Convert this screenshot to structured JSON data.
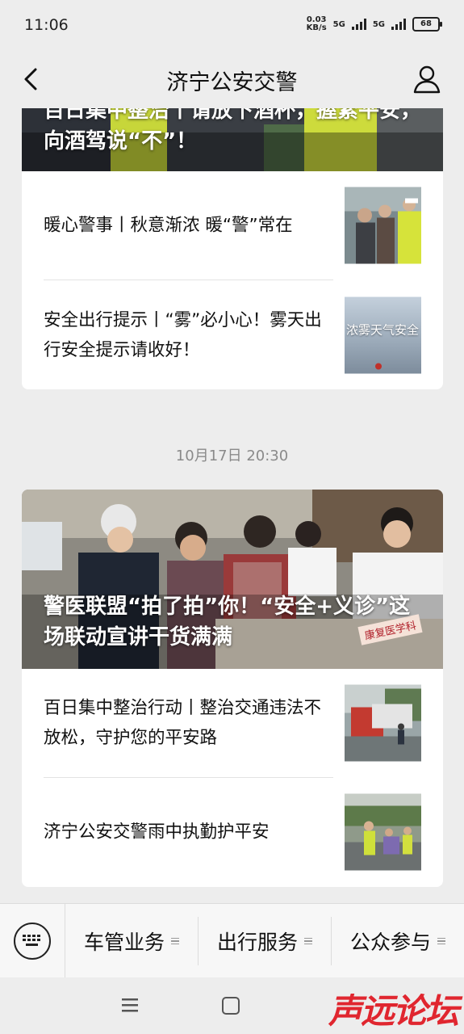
{
  "status_bar": {
    "time": "11:06",
    "speed_value": "0.03",
    "speed_unit": "KB/s",
    "network1": "5G",
    "network2": "5G",
    "battery": "68"
  },
  "nav": {
    "title": "济宁公安交警"
  },
  "feed": {
    "card1": {
      "hero_title": "百日集中整治丨请放下酒杯，握紧平安，向酒驾说“不”！",
      "items": [
        {
          "title": "暖心警事丨秋意渐浓  暖“警”常在"
        },
        {
          "title": "安全出行提示丨“雾”必小心！雾天出行安全提示请收好！",
          "thumb_text": "浓雾天气安全"
        }
      ]
    },
    "date_label": "10月17日 20:30",
    "card2": {
      "hero_title": "警医联盟“拍了拍”你！“安全+义诊”这场联动宣讲干货满满",
      "hero_sign": "康复医学科",
      "items": [
        {
          "title": "百日集中整治行动丨整治交通违法不放松，守护您的平安路"
        },
        {
          "title": "济宁公安交警雨中执勤护平安"
        }
      ]
    }
  },
  "menu": {
    "items": [
      "车管业务",
      "出行服务",
      "公众参与"
    ]
  },
  "watermark": "声远论坛",
  "colors": {
    "background": "#ededed",
    "card": "#ffffff",
    "watermark": "#e0262f",
    "muted_text": "#8a8a8a"
  }
}
